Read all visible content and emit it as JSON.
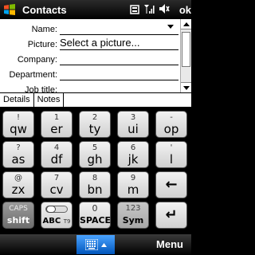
{
  "titlebar": {
    "title": "Contacts",
    "ok_label": "ok"
  },
  "form": {
    "fields": [
      {
        "label": "Name:",
        "value": ""
      },
      {
        "label": "Picture:",
        "value": "Select a picture..."
      },
      {
        "label": "Company:",
        "value": ""
      },
      {
        "label": "Department:",
        "value": ""
      },
      {
        "label": "Job title:",
        "value": ""
      }
    ]
  },
  "tabs": [
    {
      "label": "Details",
      "active": true
    },
    {
      "label": "Notes",
      "active": false
    }
  ],
  "keyboard": {
    "rows": [
      [
        {
          "top": "!",
          "main": "qw"
        },
        {
          "top": "1",
          "main": "er"
        },
        {
          "top": "2",
          "main": "ty"
        },
        {
          "top": "3",
          "main": "ui"
        },
        {
          "top": "-",
          "main": "op"
        }
      ],
      [
        {
          "top": "?",
          "main": "as"
        },
        {
          "top": "4",
          "main": "df"
        },
        {
          "top": "5",
          "main": "gh"
        },
        {
          "top": "6",
          "main": "jk"
        },
        {
          "top": "'",
          "main": "l"
        }
      ],
      [
        {
          "top": "@",
          "main": "zx"
        },
        {
          "top": "7",
          "main": "cv"
        },
        {
          "top": "8",
          "main": "bn"
        },
        {
          "top": "9",
          "main": "m"
        }
      ]
    ],
    "caps": {
      "top": "CAPS",
      "main": "shift"
    },
    "abc": {
      "main": "ABC",
      "sub": "T9"
    },
    "space": {
      "top": "0",
      "main": "SPACE"
    },
    "sym": {
      "top": "123",
      "main": "Sym"
    },
    "backspace_glyph": "←",
    "enter_glyph": "↵"
  },
  "bottombar": {
    "menu_label": "Menu"
  }
}
